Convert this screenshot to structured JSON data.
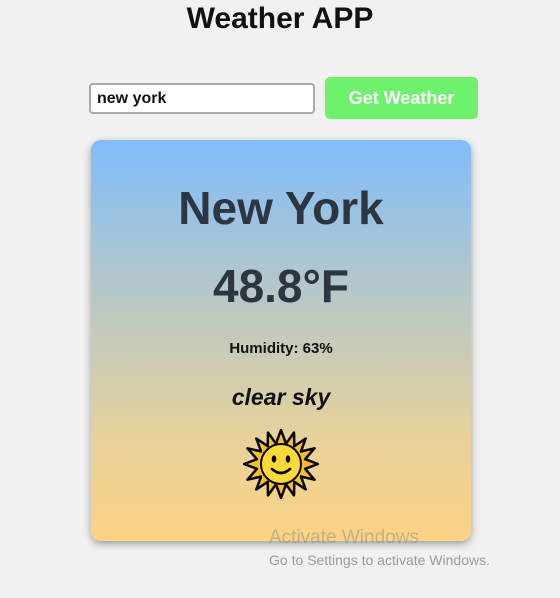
{
  "app": {
    "title": "Weather APP"
  },
  "search": {
    "value": "new york",
    "button_label": "Get Weather"
  },
  "weather": {
    "city": "New York",
    "temperature": "48.8°F",
    "humidity_label": "Humidity:",
    "humidity_value": "63%",
    "description": "clear sky",
    "icon": "sun-with-face-icon"
  },
  "watermark": {
    "title": "Activate Windows",
    "subtitle": "Go to Settings to activate Windows."
  },
  "colors": {
    "button_bg": "#6ef26e",
    "card_top": "#80bdfb",
    "card_bottom": "#fdd384",
    "city_text": "#2c3540"
  }
}
